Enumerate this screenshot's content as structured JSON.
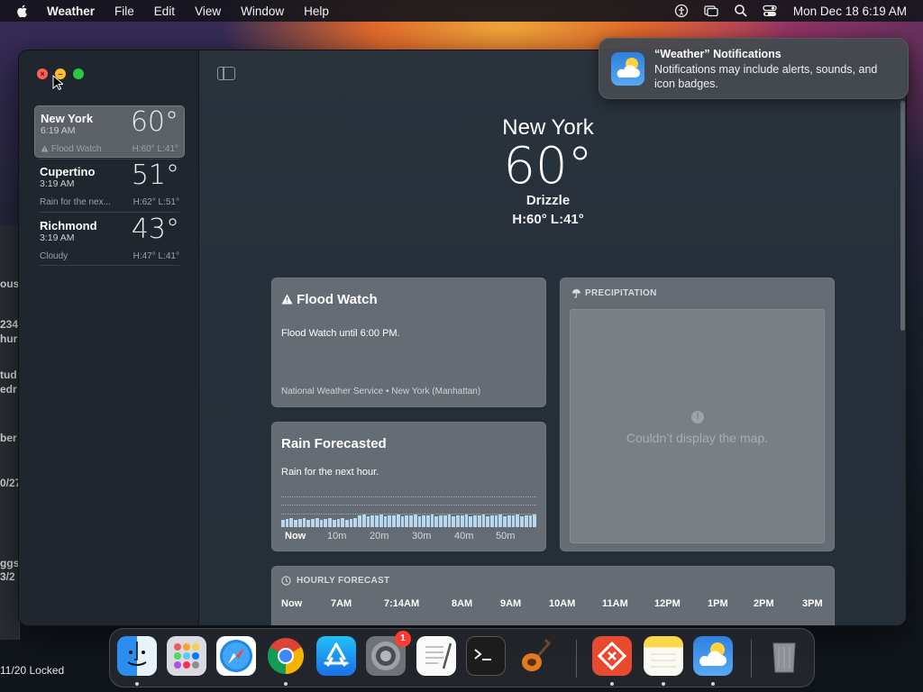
{
  "menubar": {
    "app_name": "Weather",
    "menus": [
      "File",
      "Edit",
      "View",
      "Window",
      "Help"
    ],
    "datetime": "Mon Dec 18  6:19 AM"
  },
  "background_window": {
    "fragments": [
      "ous",
      "234",
      "hurs",
      "tud",
      "edr",
      "ber",
      "0/27",
      "ggs",
      "3/2"
    ],
    "locked_text": "11/20  Locked"
  },
  "sidebar": {
    "cities": [
      {
        "name": "New York",
        "time": "6:19 AM",
        "temp": "60°",
        "condition": "Flood Watch",
        "hl": "H:60°  L:41°",
        "alert": true
      },
      {
        "name": "Cupertino",
        "time": "3:19 AM",
        "temp": "51°",
        "condition": "Rain for the nex...",
        "hl": "H:62°  L:51°",
        "alert": false
      },
      {
        "name": "Richmond",
        "time": "3:19 AM",
        "temp": "43°",
        "condition": "Cloudy",
        "hl": "H:47°  L:41°",
        "alert": false
      }
    ]
  },
  "current": {
    "city": "New York",
    "temp": "60°",
    "condition": "Drizzle",
    "hl": "H:60°  L:41°"
  },
  "flood_card": {
    "title": "Flood Watch",
    "text": "Flood Watch until 6:00 PM.",
    "source": "National Weather Service • New York (Manhattan)"
  },
  "rain_card": {
    "title": "Rain Forecasted",
    "text": "Rain for the next hour.",
    "axis": [
      "Now",
      "10m",
      "20m",
      "30m",
      "40m",
      "50m"
    ]
  },
  "precip_card": {
    "header": "PRECIPITATION",
    "message": "Couldn’t display the map."
  },
  "hourly_card": {
    "header": "HOURLY FORECAST",
    "times": [
      "Now",
      "7AM",
      "7:14AM",
      "8AM",
      "9AM",
      "10AM",
      "11AM",
      "12PM",
      "1PM",
      "2PM",
      "3PM"
    ]
  },
  "notification": {
    "title": "“Weather” Notifications",
    "body": "Notifications may include alerts, sounds, and icon badges."
  },
  "dock": {
    "items": [
      "finder-icon",
      "launchpad-icon",
      "safari-icon",
      "chrome-icon",
      "app-store-icon",
      "system-settings-icon",
      "textedit-icon",
      "terminal-icon",
      "garageband-icon",
      "remote-desktop-icon",
      "notes-icon",
      "weather-icon",
      "trash-icon"
    ],
    "settings_badge": "1"
  },
  "colors": {
    "close": "#ff5f57",
    "minimize": "#febc2e",
    "zoom": "#28c840",
    "rain_bar": "#b7d7ee"
  }
}
